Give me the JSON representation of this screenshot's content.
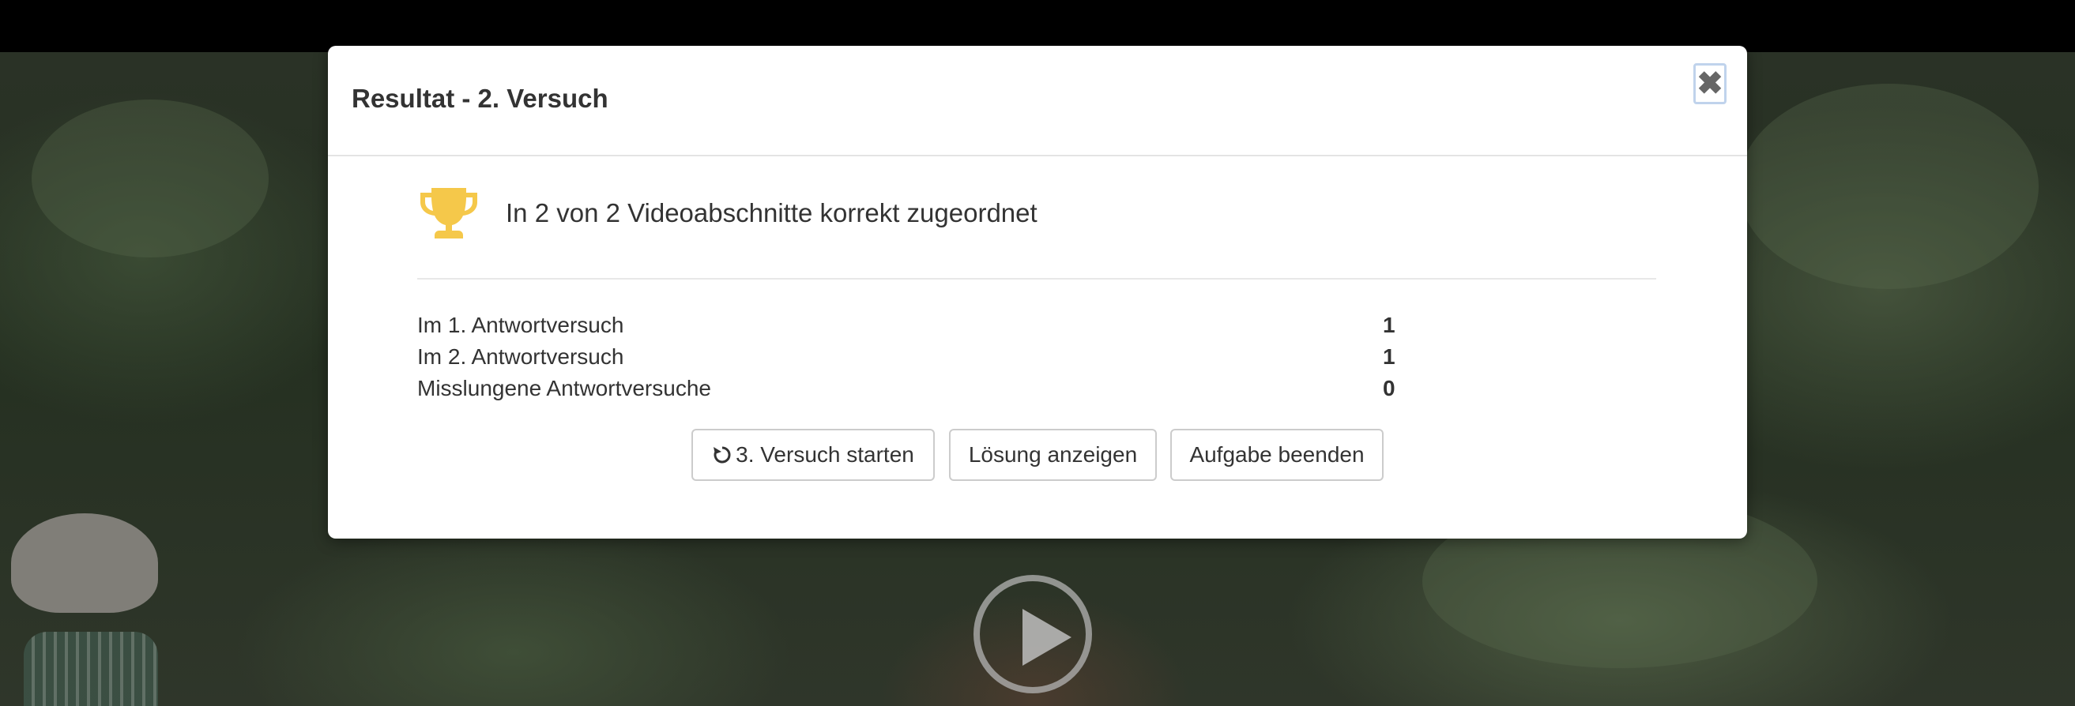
{
  "dialog": {
    "title": "Resultat - 2. Versuch",
    "close_icon": "close-icon",
    "close_glyph": "✖"
  },
  "summary": {
    "icon": "trophy-icon",
    "icon_color": "#f5c84a",
    "text": "In 2 von 2 Videoabschnitte korrekt zugeordnet"
  },
  "stats": [
    {
      "label": "Im 1. Antwortversuch",
      "value": "1"
    },
    {
      "label": "Im 2. Antwortversuch",
      "value": "1"
    },
    {
      "label": "Misslungene Antwortversuche",
      "value": "0"
    }
  ],
  "buttons": {
    "restart_label": "3. Versuch starten",
    "restart_icon": "restart-icon",
    "solution_label": "Lösung anzeigen",
    "finish_label": "Aufgabe beenden"
  },
  "video": {
    "play_icon": "play-icon"
  }
}
